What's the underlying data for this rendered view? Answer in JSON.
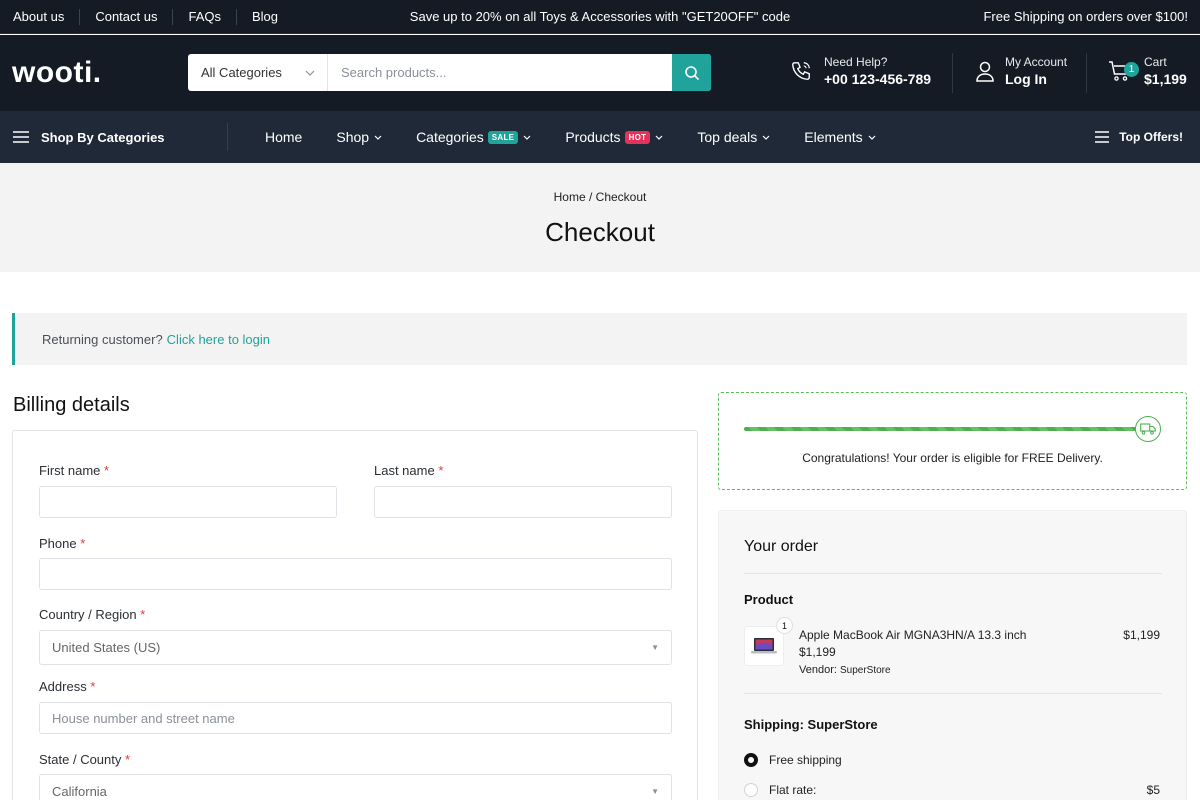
{
  "topbar": {
    "links": [
      "About us",
      "Contact us",
      "FAQs",
      "Blog"
    ],
    "promo": "Save up to 20% on all Toys & Accessories with \"GET20OFF\" code",
    "shipping": "Free Shipping on orders over $100!"
  },
  "header": {
    "logo": "wooti.",
    "search": {
      "category": "All Categories",
      "placeholder": "Search products..."
    },
    "help": {
      "label": "Need Help?",
      "phone": "+00 123-456-789"
    },
    "account": {
      "label": "My Account",
      "action": "Log In"
    },
    "cart": {
      "label": "Cart",
      "total": "$1,199",
      "count": "1"
    }
  },
  "nav": {
    "shop_by": "Shop By Categories",
    "items": {
      "home": "Home",
      "shop": "Shop",
      "categories": "Categories",
      "categories_tag": "SALE",
      "products": "Products",
      "products_tag": "HOT",
      "top_deals": "Top deals",
      "elements": "Elements"
    },
    "top_offers": "Top Offers!"
  },
  "page": {
    "breadcrumb": "Home / Checkout",
    "title": "Checkout"
  },
  "returning": {
    "text": "Returning customer?",
    "link": "Click here to login"
  },
  "billing": {
    "heading": "Billing details",
    "first_name": "First name",
    "last_name": "Last name",
    "phone": "Phone",
    "country_label": "Country / Region",
    "country_value": "United States (US)",
    "address_label": "Address",
    "address_placeholder": "House number and street name",
    "state_label": "State / County",
    "state_value": "California",
    "required_mark": "*"
  },
  "free_delivery": {
    "progress": 1.0,
    "message": "Congratulations! Your order is eligible for FREE Delivery."
  },
  "order": {
    "heading": "Your order",
    "product_heading": "Product",
    "item": {
      "qty": "1",
      "name": "Apple MacBook Air MGNA3HN/A 13.3 inch",
      "price": "$1,199",
      "vendor_label": "Vendor:",
      "vendor": "SuperStore",
      "total": "$1,199"
    },
    "shipping_heading": "Shipping: SuperStore",
    "options": {
      "free": "Free shipping",
      "flat": "Flat rate:",
      "flat_price": "$5"
    }
  },
  "colors": {
    "dark": "#141b24",
    "nav": "#1f2937",
    "accent": "#1fa39a",
    "hot": "#e2335a",
    "success": "#4caf50"
  }
}
